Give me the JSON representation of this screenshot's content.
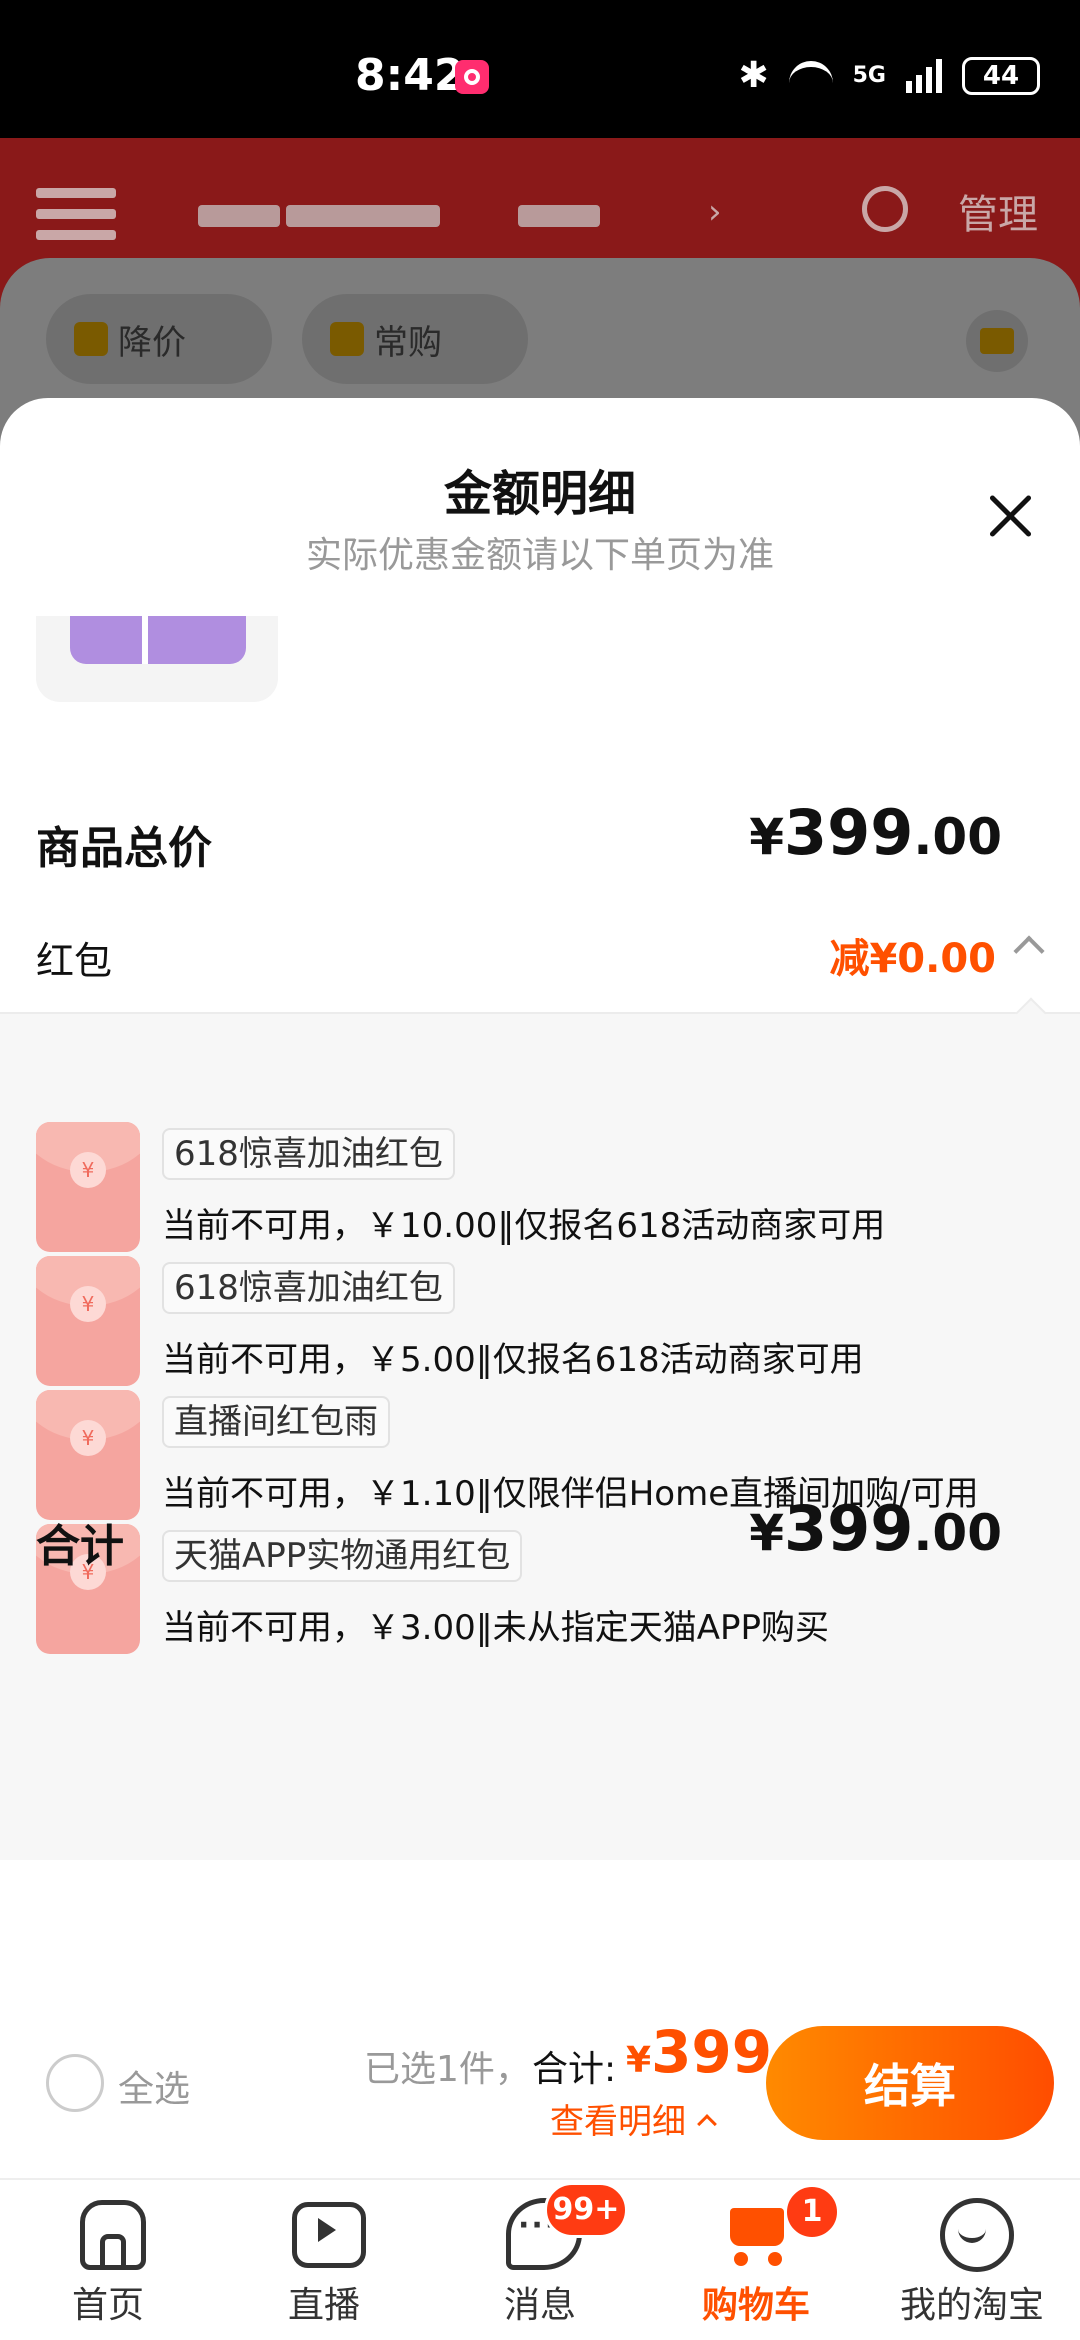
{
  "status_bar": {
    "time": "8:42",
    "network": "5G",
    "battery": "44"
  },
  "background": {
    "header": {
      "manage_label": "管理"
    },
    "chips": [
      "降价",
      "常购"
    ]
  },
  "sheet": {
    "title": "金额明细",
    "subtitle": "实际优惠金额请以下单页为准",
    "goods_total": {
      "label": "商品总价",
      "yen": "¥",
      "integer": "399",
      "decimal": ".00"
    },
    "red_packet": {
      "label": "红包",
      "value": "减¥0.00"
    },
    "red_packets": [
      {
        "tag": "618惊喜加油红包",
        "description": "当前不可用，￥10.00‖仅报名618活动商家可用"
      },
      {
        "tag": "618惊喜加油红包",
        "description": "当前不可用，￥5.00‖仅报名618活动商家可用"
      },
      {
        "tag": "直播间红包雨",
        "description": "当前不可用，￥1.10‖仅限伴侣Home直播间加购/可用"
      },
      {
        "tag": "天猫APP实物通用红包",
        "description": "当前不可用，￥3.00‖未从指定天猫APP购买"
      }
    ],
    "grand_total": {
      "label": "合计",
      "yen": "¥",
      "integer": "399",
      "decimal": ".00"
    }
  },
  "checkout": {
    "select_all_label": "全选",
    "selected_summary": "已选1件，",
    "sum_label": "合计:",
    "sum_yen": "¥",
    "sum_value": "399",
    "view_detail_label": "查看明细",
    "checkout_label": "结算"
  },
  "tabbar": {
    "tabs": [
      {
        "label": "首页",
        "icon": "home-icon"
      },
      {
        "label": "直播",
        "icon": "live-icon"
      },
      {
        "label": "消息",
        "icon": "message-icon",
        "badge": "99+"
      },
      {
        "label": "购物车",
        "icon": "cart-icon",
        "badge": "1",
        "active": true
      },
      {
        "label": "我的淘宝",
        "icon": "profile-icon"
      }
    ]
  },
  "colors": {
    "accent": "#ff5000",
    "header_bg": "#8a1919",
    "checkout_gradient_start": "#ff8a00",
    "checkout_gradient_end": "#ff4d00"
  }
}
